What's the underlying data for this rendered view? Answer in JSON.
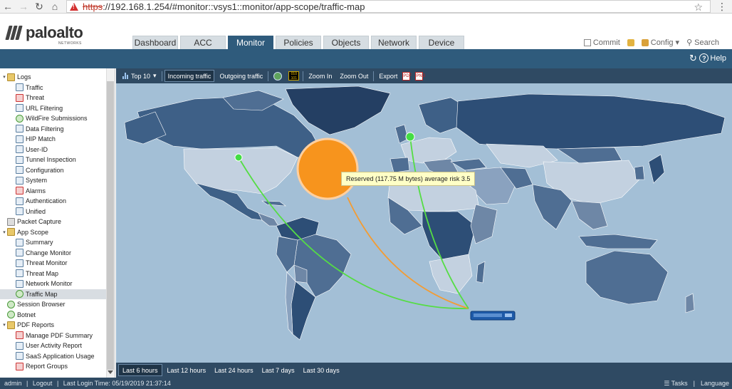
{
  "browser": {
    "url_scheme": "https",
    "url_rest": "://192.168.1.254/#monitor::vsys1::monitor/app-scope/traffic-map"
  },
  "app": {
    "logo_text": "paloalto",
    "logo_sub": "NETWORKS",
    "tabs": [
      {
        "label": "Dashboard",
        "active": false
      },
      {
        "label": "ACC",
        "active": false
      },
      {
        "label": "Monitor",
        "active": true
      },
      {
        "label": "Policies",
        "active": false
      },
      {
        "label": "Objects",
        "active": false
      },
      {
        "label": "Network",
        "active": false
      },
      {
        "label": "Device",
        "active": false
      }
    ],
    "actions": {
      "commit": "Commit",
      "config": "Config",
      "search": "Search",
      "help": "Help"
    }
  },
  "sidebar": {
    "items": [
      {
        "label": "Logs",
        "level": 0,
        "toggle": "▾",
        "icon": "folder-icon",
        "selected": false
      },
      {
        "label": "Traffic",
        "level": 1,
        "icon": "traffic-log-icon",
        "selected": false
      },
      {
        "label": "Threat",
        "level": 1,
        "icon": "threat-log-icon",
        "selected": false
      },
      {
        "label": "URL Filtering",
        "level": 1,
        "icon": "url-filtering-icon",
        "selected": false
      },
      {
        "label": "WildFire Submissions",
        "level": 1,
        "icon": "wildfire-icon",
        "selected": false
      },
      {
        "label": "Data Filtering",
        "level": 1,
        "icon": "data-filtering-icon",
        "selected": false
      },
      {
        "label": "HIP Match",
        "level": 1,
        "icon": "hip-match-icon",
        "selected": false
      },
      {
        "label": "User-ID",
        "level": 1,
        "icon": "user-id-icon",
        "selected": false
      },
      {
        "label": "Tunnel Inspection",
        "level": 1,
        "icon": "tunnel-icon",
        "selected": false
      },
      {
        "label": "Configuration",
        "level": 1,
        "icon": "configuration-icon",
        "selected": false
      },
      {
        "label": "System",
        "level": 1,
        "icon": "system-icon",
        "selected": false
      },
      {
        "label": "Alarms",
        "level": 1,
        "icon": "alarms-icon",
        "selected": false
      },
      {
        "label": "Authentication",
        "level": 1,
        "icon": "authentication-icon",
        "selected": false
      },
      {
        "label": "Unified",
        "level": 1,
        "icon": "unified-icon",
        "selected": false
      },
      {
        "label": "Packet Capture",
        "level": 0,
        "toggle": "",
        "icon": "packet-capture-icon",
        "selected": false
      },
      {
        "label": "App Scope",
        "level": 0,
        "toggle": "▾",
        "icon": "folder-icon",
        "selected": false
      },
      {
        "label": "Summary",
        "level": 1,
        "icon": "summary-icon",
        "selected": false
      },
      {
        "label": "Change Monitor",
        "level": 1,
        "icon": "change-monitor-icon",
        "selected": false
      },
      {
        "label": "Threat Monitor",
        "level": 1,
        "icon": "threat-monitor-icon",
        "selected": false
      },
      {
        "label": "Threat Map",
        "level": 1,
        "icon": "threat-map-icon",
        "selected": false
      },
      {
        "label": "Network Monitor",
        "level": 1,
        "icon": "network-monitor-icon",
        "selected": false
      },
      {
        "label": "Traffic Map",
        "level": 1,
        "icon": "traffic-map-icon",
        "selected": true
      },
      {
        "label": "Session Browser",
        "level": 0,
        "toggle": "",
        "icon": "session-browser-icon",
        "selected": false
      },
      {
        "label": "Botnet",
        "level": 0,
        "toggle": "",
        "icon": "botnet-icon",
        "selected": false
      },
      {
        "label": "PDF Reports",
        "level": 0,
        "toggle": "▾",
        "icon": "folder-icon",
        "selected": false
      },
      {
        "label": "Manage PDF Summary",
        "level": 1,
        "icon": "pdf-summary-icon",
        "selected": false
      },
      {
        "label": "User Activity Report",
        "level": 1,
        "icon": "user-activity-icon",
        "selected": false
      },
      {
        "label": "SaaS Application Usage",
        "level": 1,
        "icon": "saas-icon",
        "selected": false
      },
      {
        "label": "Report Groups",
        "level": 1,
        "icon": "report-groups-icon",
        "selected": false
      }
    ]
  },
  "map_toolbar": {
    "top10": "Top 10",
    "incoming": "Incoming traffic",
    "outgoing": "Outgoing traffic",
    "bin_icon_text": "010 101",
    "zoom_in": "Zoom In",
    "zoom_out": "Zoom Out",
    "export": "Export"
  },
  "map": {
    "tooltip": "Reserved (117.75 M bytes) average risk 3.5",
    "colors": {
      "ocean": "#a3bfd6",
      "land_dark": "#2d4e76",
      "land_mid": "#4f6e93",
      "land_light": "#c3d1e0",
      "big_bubble": "#f7941d",
      "small_bubble": "#44dd44",
      "arc_green": "#55dd44",
      "arc_orange": "#f39c33"
    }
  },
  "time_bar": {
    "options": [
      {
        "label": "Last 6 hours",
        "active": true
      },
      {
        "label": "Last 12 hours",
        "active": false
      },
      {
        "label": "Last 24 hours",
        "active": false
      },
      {
        "label": "Last 7 days",
        "active": false
      },
      {
        "label": "Last 30 days",
        "active": false
      }
    ]
  },
  "status": {
    "user": "admin",
    "logout": "Logout",
    "last_login": "Last Login Time: 05/19/2019 21:37:14",
    "tasks": "Tasks",
    "language": "Language"
  }
}
